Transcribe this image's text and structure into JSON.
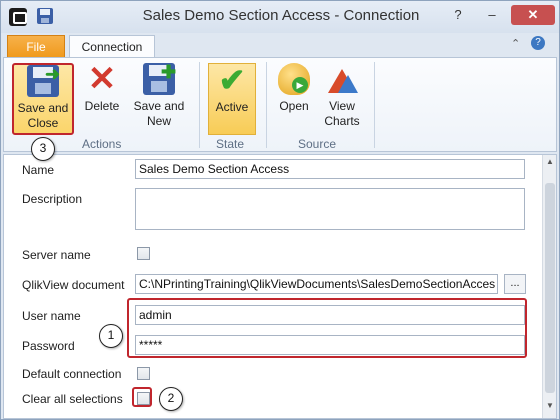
{
  "window": {
    "title": "Sales Demo Section Access - Connection"
  },
  "title_buttons": {
    "help": "?",
    "minimize": "–",
    "close": "✕"
  },
  "tabs": {
    "file": "File",
    "connection": "Connection"
  },
  "ribbon": {
    "save_close": "Save and Close",
    "delete": "Delete",
    "save_new": "Save and New",
    "active": "Active",
    "open": "Open",
    "view_charts": "View Charts",
    "groups": {
      "actions": "Actions",
      "state": "State",
      "source": "Source"
    }
  },
  "form": {
    "name_label": "Name",
    "name_value": "Sales Demo Section Access",
    "description_label": "Description",
    "description_value": "",
    "server_label": "Server name",
    "qv_label": "QlikView document",
    "qv_value": "C:\\NPrintingTraining\\QlikViewDocuments\\SalesDemoSectionAcces",
    "browse_label": "...",
    "user_label": "User name",
    "user_value": "admin",
    "password_label": "Password",
    "password_value": "*****",
    "default_conn_label": "Default connection",
    "clear_sel_label": "Clear all selections"
  },
  "callouts": {
    "one": "1",
    "two": "2",
    "three": "3"
  },
  "colors": {
    "highlight": "#c0262d",
    "file_tab": "#f09a1d",
    "active": "#f8cc56"
  },
  "icons": [
    "app-icon",
    "save-icon",
    "save-close-icon",
    "delete-icon",
    "save-new-icon",
    "check-icon",
    "open-icon",
    "chart-icon"
  ]
}
